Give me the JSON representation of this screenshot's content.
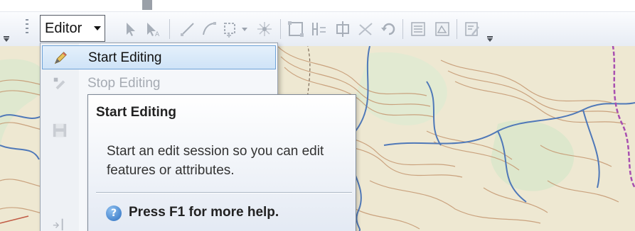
{
  "toolbar": {
    "editor_label": "Editor"
  },
  "menu": {
    "items": [
      {
        "label": "Start Editing",
        "icon": "pencil-icon",
        "enabled": true,
        "highlighted": true
      },
      {
        "label": "Stop Editing",
        "icon": "stop-editing-icon",
        "enabled": false,
        "highlighted": false
      }
    ]
  },
  "tooltip": {
    "title": "Start Editing",
    "body": "Start an edit session so you can edit features or attributes.",
    "help": "Press F1 for more help."
  },
  "colors": {
    "highlight": "#cfe3f7",
    "highlight_border": "#6fa3d8",
    "map_bg": "#efe9d4",
    "contour": "#c69a74",
    "river": "#4f78b8"
  }
}
